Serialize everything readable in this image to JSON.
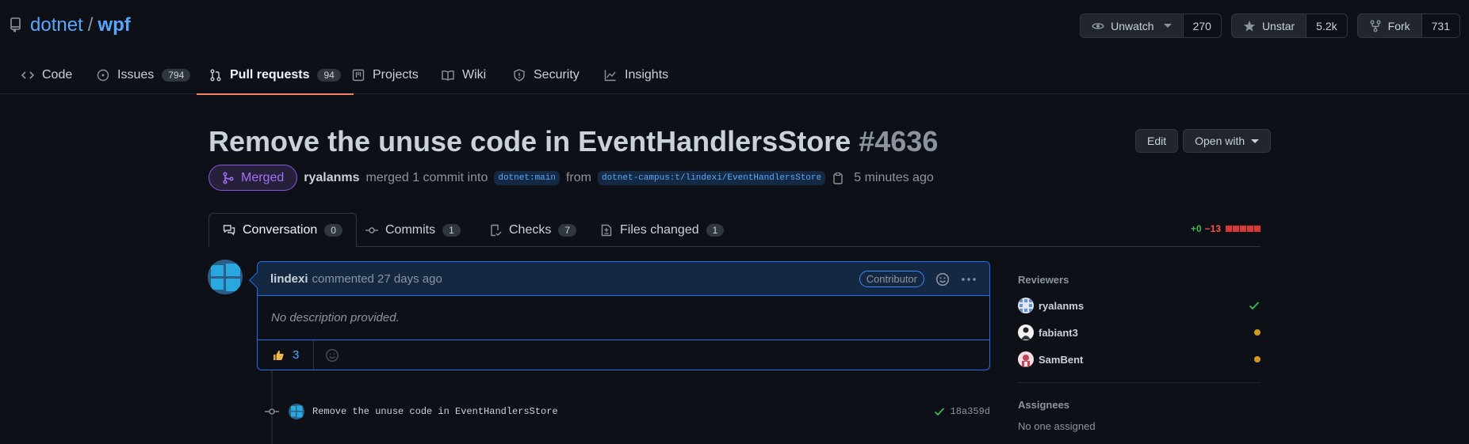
{
  "repo": {
    "owner": "dotnet",
    "separator": "/",
    "name": "wpf"
  },
  "repo_actions": {
    "watch": {
      "label": "Unwatch",
      "count": "270"
    },
    "star": {
      "label": "Unstar",
      "count": "5.2k"
    },
    "fork": {
      "label": "Fork",
      "count": "731"
    }
  },
  "tabs": [
    {
      "label": "Code"
    },
    {
      "label": "Issues",
      "count": "794"
    },
    {
      "label": "Pull requests",
      "count": "94"
    },
    {
      "label": "Projects"
    },
    {
      "label": "Wiki"
    },
    {
      "label": "Security"
    },
    {
      "label": "Insights"
    }
  ],
  "pr": {
    "title": "Remove the unuse code in EventHandlersStore",
    "number": "#4636",
    "state": "Merged",
    "author": "ryalanms",
    "action": "merged 1 commit into",
    "base_branch": "dotnet:main",
    "from_word": "from",
    "head_branch": "dotnet-campus:t/lindexi/EventHandlersStore",
    "time": "5 minutes ago",
    "edit_label": "Edit",
    "open_with_label": "Open with"
  },
  "pr_tabs": [
    {
      "label": "Conversation",
      "count": "0"
    },
    {
      "label": "Commits",
      "count": "1"
    },
    {
      "label": "Checks",
      "count": "7"
    },
    {
      "label": "Files changed",
      "count": "1"
    }
  ],
  "diffstat": {
    "additions": "+0",
    "deletions": "−13"
  },
  "comment": {
    "author": "lindexi",
    "action": "commented 27 days ago",
    "role": "Contributor",
    "body": "No description provided.",
    "reaction_count": "3"
  },
  "commit": {
    "message": "Remove the unuse code in EventHandlersStore",
    "sha": "18a359d"
  },
  "sidebar": {
    "reviewers_heading": "Reviewers",
    "reviewers": [
      {
        "name": "ryalanms",
        "status": "approved"
      },
      {
        "name": "fabiant3",
        "status": "pending"
      },
      {
        "name": "SamBent",
        "status": "pending"
      }
    ],
    "assignees_heading": "Assignees",
    "assignees_empty": "No one assigned"
  },
  "colors": {
    "merged": "#a371f7",
    "accent": "#58a6ff",
    "tab_underline": "#f78166",
    "approved": "#3fb950",
    "pending": "#d29922",
    "deletions": "#f85149"
  }
}
